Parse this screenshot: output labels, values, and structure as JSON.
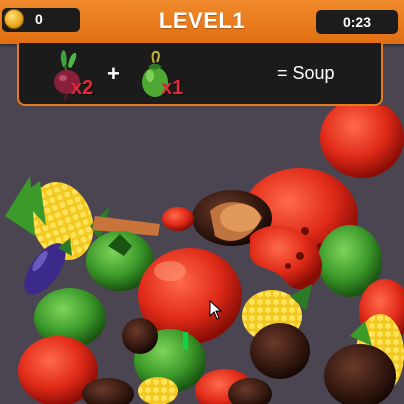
{
  "hud": {
    "coins": "0",
    "level": "LEVEL1",
    "timer": "0:23"
  },
  "recipe": {
    "ingredients": [
      {
        "icon": "beet-icon",
        "quantity": "x2"
      },
      {
        "icon": "green-tomato-icon",
        "quantity": "x1"
      }
    ],
    "plus_sign": "+",
    "result": "= Soup"
  },
  "colors": {
    "topbar": "#e97c20",
    "panel": "#1b1b1b",
    "quantity_text": "#e8263a",
    "background": "#4a4550"
  }
}
